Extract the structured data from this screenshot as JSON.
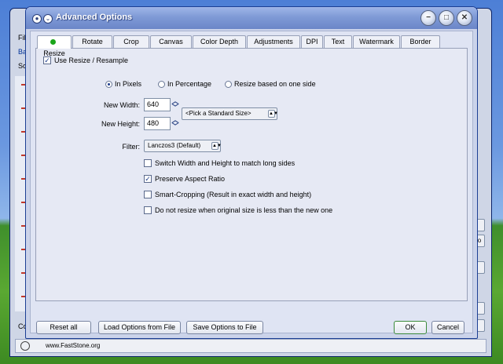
{
  "background_window": {
    "menu_fragment": "File",
    "tab_fragment": "Bat",
    "list_fragment": "So",
    "right_button_fragment": "o",
    "bottom_fragment": "Co",
    "status_url": "www.FastStone.org"
  },
  "dialog": {
    "title": "Advanced Options",
    "sys_icons": {
      "left": "circle-icon",
      "right": "chevron-icon"
    },
    "caption_buttons": {
      "minimize": "−",
      "maximize": "□",
      "close": "✕"
    }
  },
  "tabs": [
    {
      "label": "Resize",
      "active": true
    },
    {
      "label": "Rotate"
    },
    {
      "label": "Crop"
    },
    {
      "label": "Canvas"
    },
    {
      "label": "Color Depth"
    },
    {
      "label": "Adjustments"
    },
    {
      "label": "DPI"
    },
    {
      "label": "Text"
    },
    {
      "label": "Watermark"
    },
    {
      "label": "Border"
    }
  ],
  "resize": {
    "use_resize_label": "Use Resize / Resample",
    "use_resize_checked": true,
    "radios": [
      {
        "label": "In Pixels",
        "selected": true
      },
      {
        "label": "In Percentage",
        "selected": false
      },
      {
        "label": "Resize based on one side",
        "selected": false
      }
    ],
    "new_width_label": "New Width:",
    "new_width_value": "640",
    "new_height_label": "New Height:",
    "new_height_value": "480",
    "standard_size_value": "<Pick a Standard Size>",
    "filter_label": "Filter:",
    "filter_value": "Lanczos3 (Default)",
    "options": [
      {
        "label": "Switch Width and Height to match long sides",
        "checked": false
      },
      {
        "label": "Preserve Aspect Ratio",
        "checked": true
      },
      {
        "label": "Smart-Cropping (Result in exact width and height)",
        "checked": false
      },
      {
        "label": "Do not resize when original size is less than the new one",
        "checked": false
      }
    ]
  },
  "footer": {
    "reset_all": "Reset all",
    "load_options": "Load Options from File",
    "save_options": "Save Options to File",
    "ok": "OK",
    "cancel": "Cancel"
  },
  "colors": {
    "title_gradient_top": "#9fb6e8",
    "ok_border": "#3a8a3a",
    "active_tab_dot": "#1aa51a"
  }
}
